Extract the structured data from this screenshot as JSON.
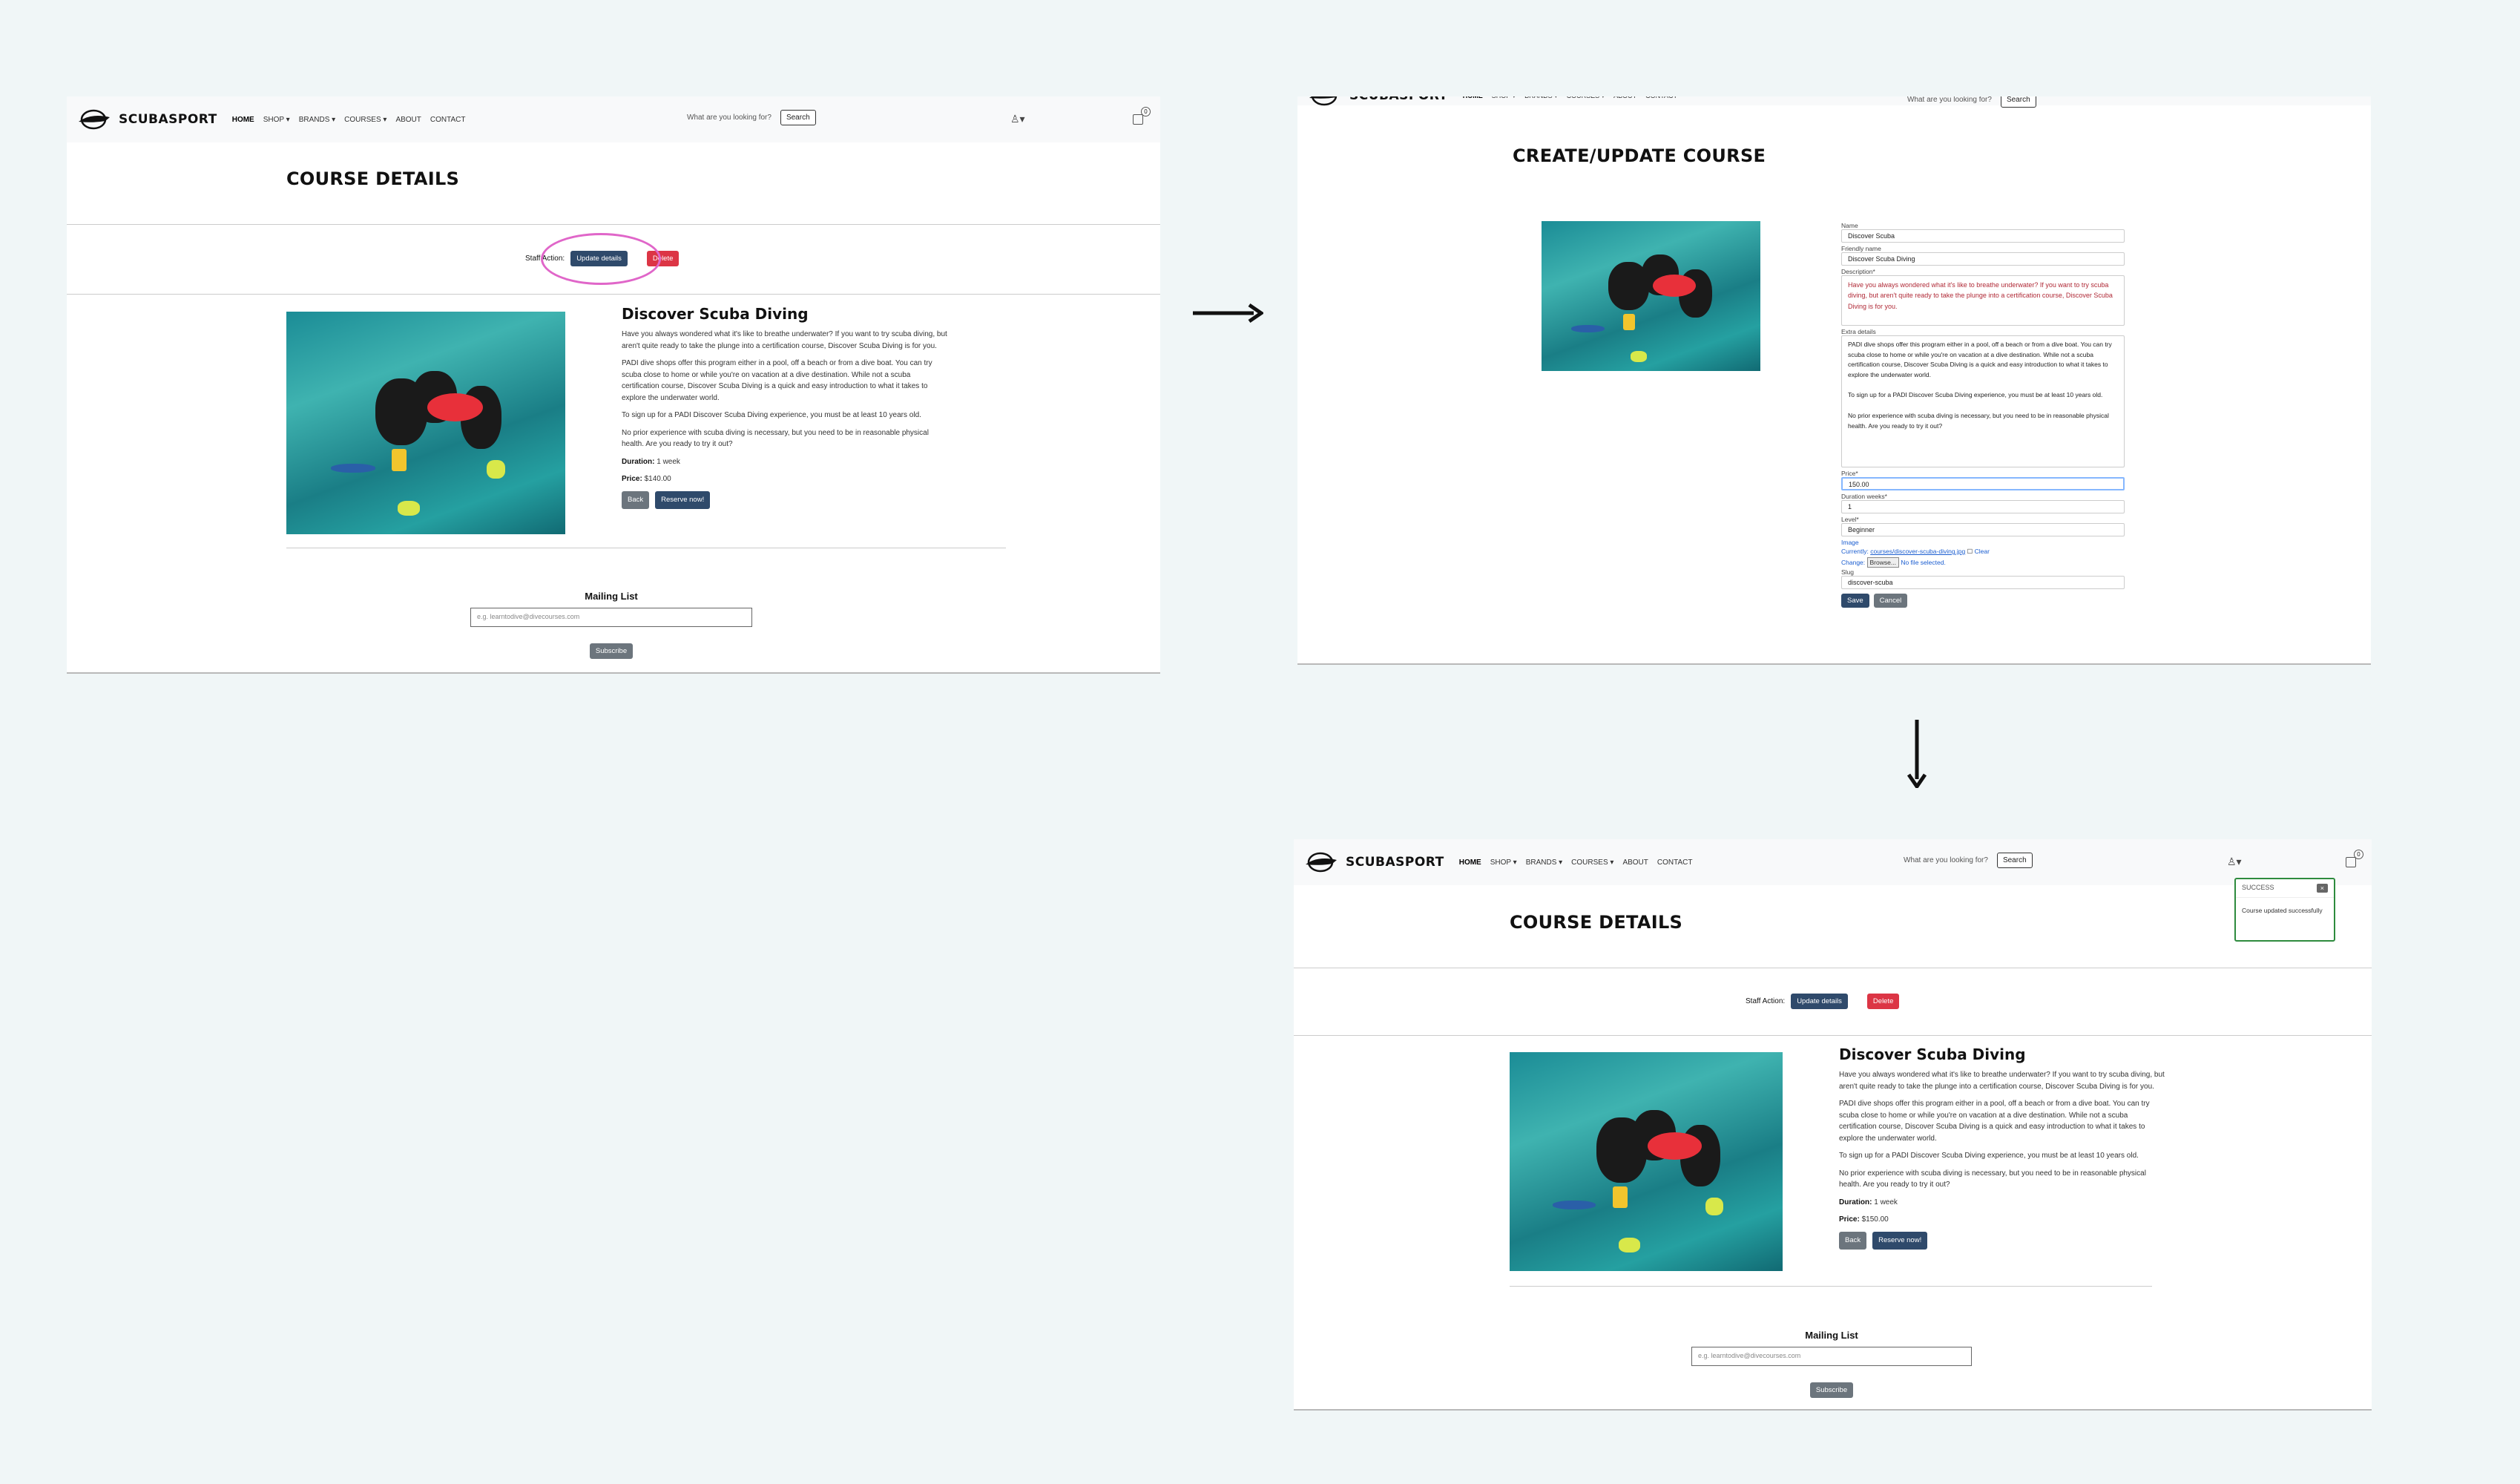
{
  "nav": {
    "brand": "SCUBASPORT",
    "links": [
      "HOME",
      "SHOP ▾",
      "BRANDS ▾",
      "COURSES ▾",
      "ABOUT",
      "CONTACT"
    ],
    "search_placeholder": "What are you looking for?",
    "search_button": "Search",
    "cart_count": "0"
  },
  "detail_page": {
    "title": "COURSE DETAILS",
    "staff_label": "Staff Action:",
    "update_button": "Update details",
    "delete_button": "Delete",
    "course_name": "Discover Scuba Diving",
    "para1": "Have you always wondered what it's like to breathe underwater? If you want to try scuba diving, but aren't quite ready to take the plunge into a certification course, Discover Scuba Diving is for you.",
    "para2": "PADI dive shops offer this program either in a pool, off a beach or from a dive boat. You can try scuba close to home or while you're on vacation at a dive destination. While not a scuba certification course, Discover Scuba Diving is a quick and easy introduction to what it takes to explore the underwater world.",
    "para3": "To sign up for a PADI Discover Scuba Diving experience, you must be at least 10 years old.",
    "para4": "No prior experience with scuba diving is necessary, but you need to be in reasonable physical health. Are you ready to try it out?",
    "duration_label": "Duration:",
    "duration_value": "1 week",
    "price_label": "Price:",
    "price_before": "$140.00",
    "price_after": "$150.00",
    "back_button": "Back",
    "reserve_button": "Reserve now!",
    "mailing_title": "Mailing List",
    "mailing_placeholder": "e.g. learntodive@divecourses.com",
    "subscribe_button": "Subscribe"
  },
  "form_page": {
    "title": "CREATE/UPDATE COURSE",
    "name_label": "Name",
    "name_value": "Discover Scuba",
    "friendly_label": "Friendly name",
    "friendly_value": "Discover Scuba Diving",
    "description_label": "Description*",
    "description_value": "Have you always wondered what it's like to breathe underwater? If you want to try scuba diving, but aren't quite ready to take the plunge into a certification course, Discover Scuba Diving is for you.",
    "extra_label": "Extra details",
    "extra_p1": "PADI dive shops offer this program either in a pool, off a beach or from a dive boat. You can try scuba close to home or while you're on vacation at a dive destination. While not a scuba certification course, Discover Scuba Diving is a quick and easy introduction to what it takes to explore the underwater world.",
    "extra_p2": "To sign up for a PADI Discover Scuba Diving experience, you must be at least 10 years old.",
    "extra_p3": "No prior experience with scuba diving is necessary, but you need to be in reasonable physical health. Are you ready to try it out?",
    "price_label": "Price*",
    "price_value": "150.00",
    "duration_label": "Duration weeks*",
    "duration_value": "1",
    "level_label": "Level*",
    "level_value": "Beginner",
    "image_label": "Image",
    "currently_label": "Currently:",
    "currently_link": "courses/discover-scuba-diving.jpg",
    "clear_label": "Clear",
    "change_label": "Change:",
    "browse_button": "Browse...",
    "no_file": "No file selected.",
    "slug_label": "Slug",
    "slug_value": "discover-scuba",
    "save_button": "Save",
    "cancel_button": "Cancel"
  },
  "toast": {
    "title": "SUCCESS",
    "message": "Course updated successfully",
    "close": "×",
    "border_color": "#2e8b3e"
  },
  "colors": {
    "navy": "#2f4a6b",
    "red": "#dc3545",
    "grey": "#6c757d",
    "highlight": "#e066c9"
  }
}
